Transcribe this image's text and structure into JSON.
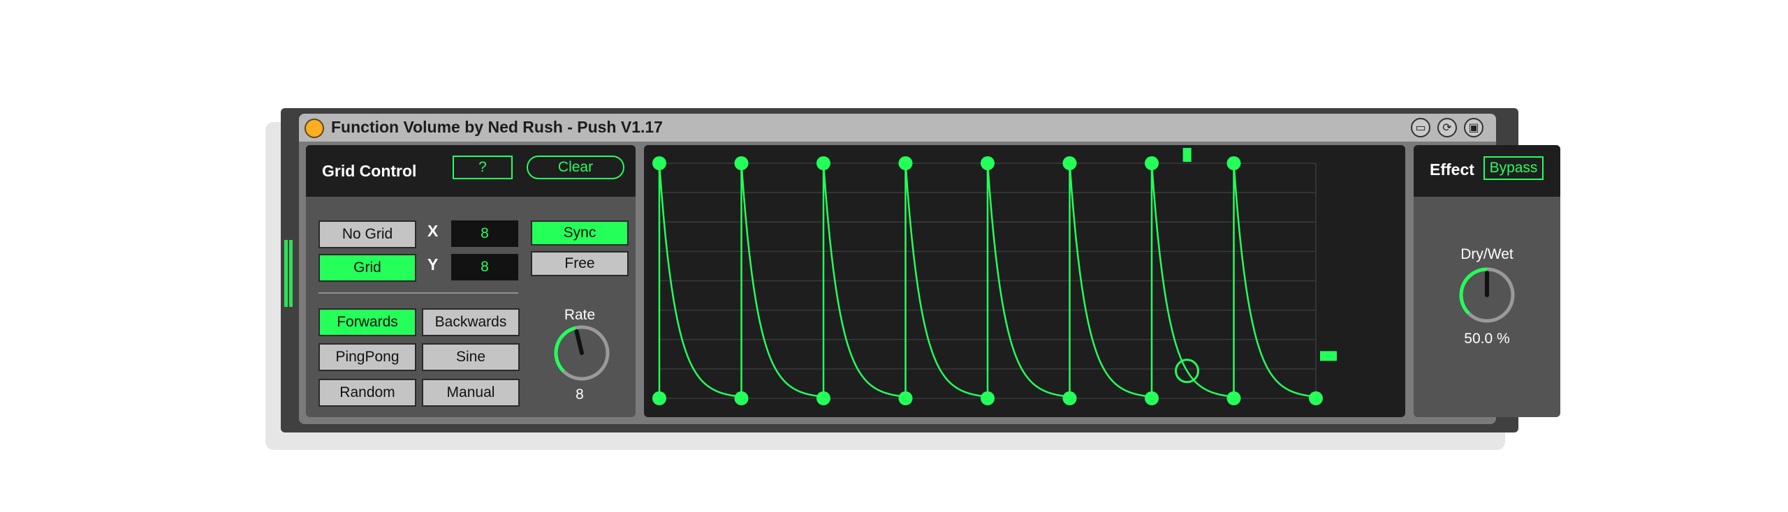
{
  "title": "Function Volume by Ned Rush - Push V1.17",
  "title_icons": [
    "mapping-icon",
    "hot-swap-icon",
    "save-preset-icon"
  ],
  "grid_control": {
    "heading": "Grid Control",
    "help_label": "?",
    "clear_label": "Clear",
    "no_grid_label": "No Grid",
    "grid_label": "Grid",
    "x_label": "X",
    "x_value": "8",
    "y_label": "Y",
    "y_value": "8",
    "sync_label": "Sync",
    "free_label": "Free",
    "forwards_label": "Forwards",
    "backwards_label": "Backwards",
    "pingpong_label": "PingPong",
    "sine_label": "Sine",
    "random_label": "Random",
    "manual_label": "Manual",
    "rate_label": "Rate",
    "rate_value": "8",
    "rate_level": 0.45,
    "selected_grid": "Grid",
    "selected_sync": "Sync",
    "selected_mode": "Forwards"
  },
  "envelope": {
    "grid_divisions": 8,
    "segments": 8,
    "playhead_position": 0.75,
    "output_level": 0.18,
    "current_phase": 0.43
  },
  "effect": {
    "heading": "Effect",
    "bypass_label": "Bypass",
    "drywet_label": "Dry/Wet",
    "drywet_value": "50.0 %",
    "drywet_level": 0.5
  },
  "colors": {
    "accent": "#24ff5a",
    "device_bg": "#7a7a7a",
    "panel_bg": "#545454",
    "display_bg": "#1e1e1e",
    "power": "#ffad21"
  }
}
